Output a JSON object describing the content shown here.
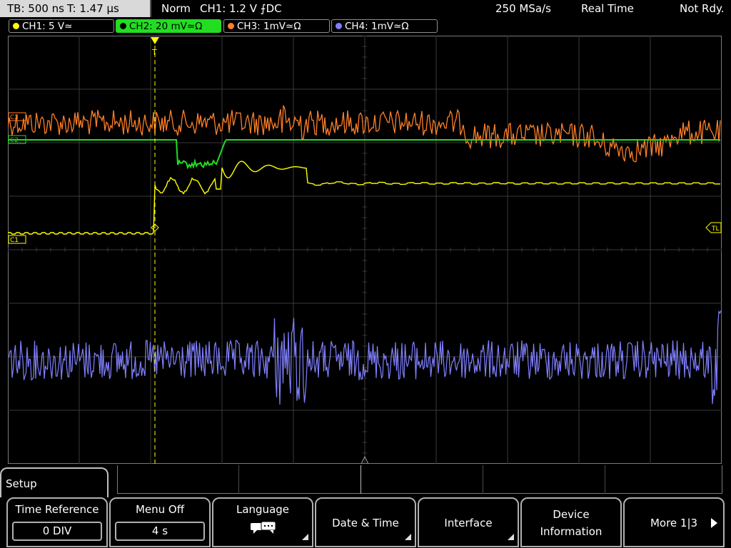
{
  "status": {
    "timebase": "TB: 500 ns",
    "trigger_time": "T: 1.47 µs",
    "trigger_mode": "Norm",
    "trigger_source": "CH1: 1.2 V ⨍DC",
    "sample_rate": "250 MSa/s",
    "acq_mode": "Real Time",
    "state": "Not Rdy."
  },
  "channels": [
    {
      "label": "CH1: 5 V≃",
      "color": "#ffff00"
    },
    {
      "label": "CH2: 20 mV≃Ω",
      "color": "#22dd22"
    },
    {
      "label": "CH3: 1mV≃Ω",
      "color": "#ff7f27"
    },
    {
      "label": "CH4: 1mV≃Ω",
      "color": "#8080ff"
    }
  ],
  "markers": {
    "c3": "C3",
    "c2": "C2",
    "c1": "C1",
    "tl": "TL",
    "trigger_pos": "T"
  },
  "menu": {
    "title": "Setup",
    "keys": [
      {
        "label": "Time Reference",
        "value": "0 DIV"
      },
      {
        "label": "Menu Off",
        "value": "4 s"
      },
      {
        "label": "Language",
        "icon": "speech-bubble-icon"
      },
      {
        "label": "Date & Time"
      },
      {
        "label": "Interface"
      },
      {
        "label_line1": "Device",
        "label_line2": "Information"
      },
      {
        "label": "More 1|3"
      }
    ]
  }
}
